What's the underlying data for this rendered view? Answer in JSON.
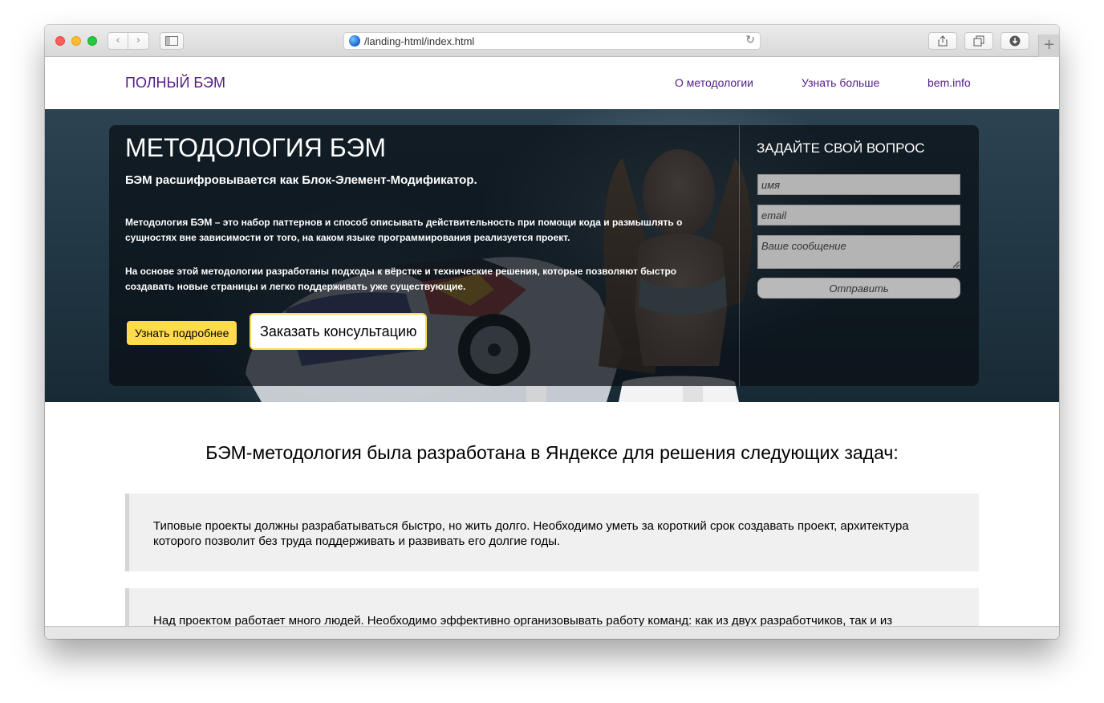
{
  "browser": {
    "url": "/landing-html/index.html",
    "icons": {
      "back": "chevron-left-icon",
      "forward": "chevron-right-icon",
      "sidebar": "sidebar-icon",
      "reload": "reload-icon",
      "share": "share-icon",
      "tabs": "tabs-icon",
      "download": "download-icon",
      "new_tab": "plus-icon"
    }
  },
  "header": {
    "logo": "ПОЛНЫЙ БЭМ",
    "nav": [
      "О методологии",
      "Узнать больше",
      "bem.info"
    ]
  },
  "hero": {
    "title": "МЕТОДОЛОГИЯ БЭМ",
    "subtitle": "БЭМ расшифровывается как Блок-Элемент-Модификатор.",
    "paragraph_1": "Методология БЭМ – это набор паттернов и способ описывать действительность при помощи кода и размышлять о сущностях вне зависимости от того, на каком языке программирования реализуется проект.",
    "paragraph_2": "На основе этой методологии разработаны подходы к вёрстке и технические решения, которые позволяют быстро создавать новые страницы и легко поддерживать уже существующие.",
    "primary_button": "Узнать подробнее",
    "secondary_button": "Заказать консультацию"
  },
  "form": {
    "title": "ЗАДАЙТЕ СВОЙ ВОПРОС",
    "name_placeholder": "имя",
    "email_placeholder": "email",
    "message_placeholder": "Ваше сообщение",
    "submit": "Отправить"
  },
  "tasks": {
    "title": "БЭМ-методология была разработана в Яндексе для решения следующих задач:",
    "items": [
      "Типовые проекты должны разрабатываться быстро, но жить долго. Необходимо уметь за короткий срок создавать проект, архитектура которого позволит без труда поддерживать и развивать его долгие годы.",
      "Над проектом работает много людей. Необходимо эффективно организовывать работу команд: как из двух разработчиков, так и из"
    ]
  },
  "colors": {
    "link": "#551a8b",
    "accent_yellow": "#ffdb4d",
    "hero_overlay": "#080e13",
    "card_bg": "#f0f0f0"
  }
}
